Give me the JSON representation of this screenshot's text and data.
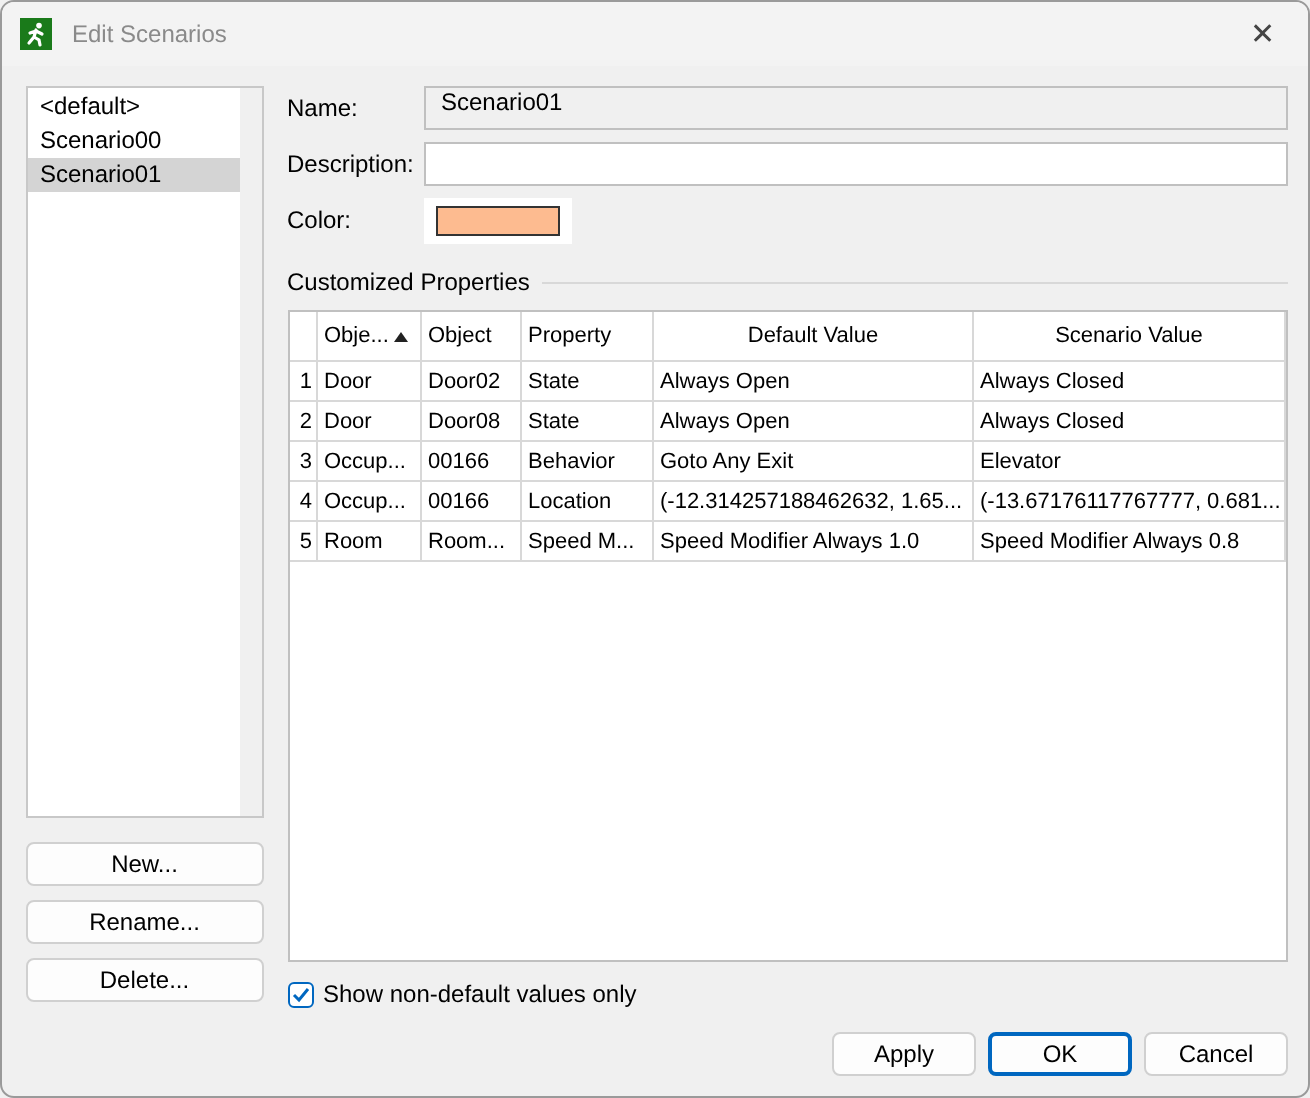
{
  "window": {
    "title": "Edit Scenarios",
    "close": "✕"
  },
  "scenarios": [
    {
      "label": "<default>",
      "selected": false
    },
    {
      "label": "Scenario00",
      "selected": false
    },
    {
      "label": "Scenario01",
      "selected": true
    }
  ],
  "list_buttons": [
    "New...",
    "Rename...",
    "Delete..."
  ],
  "fields": {
    "name": {
      "label": "Name:",
      "value": "Scenario01",
      "disabled": true
    },
    "description": {
      "label": "Description:"
    },
    "color": {
      "label": "Color:",
      "color": "#fdbb90"
    }
  },
  "section": "Customized Properties",
  "table": {
    "columns": [
      {
        "label": "Obje...",
        "sorted": true
      },
      {
        "label": "Object",
        "sorted": false
      },
      {
        "label": "Property",
        "sorted": false
      },
      {
        "label": "Default Value",
        "sorted": false
      },
      {
        "label": "Scenario Value",
        "sorted": false
      }
    ],
    "rows": [
      {
        "number": "1",
        "cells": [
          "Door",
          "Door02",
          "State",
          "Always Open",
          "Always Closed"
        ]
      },
      {
        "number": "2",
        "cells": [
          "Door",
          "Door08",
          "State",
          "Always Open",
          "Always Closed"
        ]
      },
      {
        "number": "3",
        "cells": [
          "Occup...",
          "00166",
          "Behavior",
          "Goto Any Exit",
          "Elevator"
        ]
      },
      {
        "number": "4",
        "cells": [
          "Occup...",
          "00166",
          "Location",
          "(-12.314257188462632, 1.65...",
          "(-13.67176117767777, 0.681..."
        ]
      },
      {
        "number": "5",
        "cells": [
          "Room",
          "Room...",
          "Speed M...",
          "Speed Modifier Always 1.0",
          "Speed Modifier Always 0.8"
        ]
      }
    ]
  },
  "show_non_default": {
    "label": "Show non-default values only",
    "checked": true
  },
  "buttons": [
    {
      "label": "Apply",
      "default": false
    },
    {
      "label": "OK",
      "default": true
    },
    {
      "label": "Cancel",
      "default": false
    }
  ]
}
